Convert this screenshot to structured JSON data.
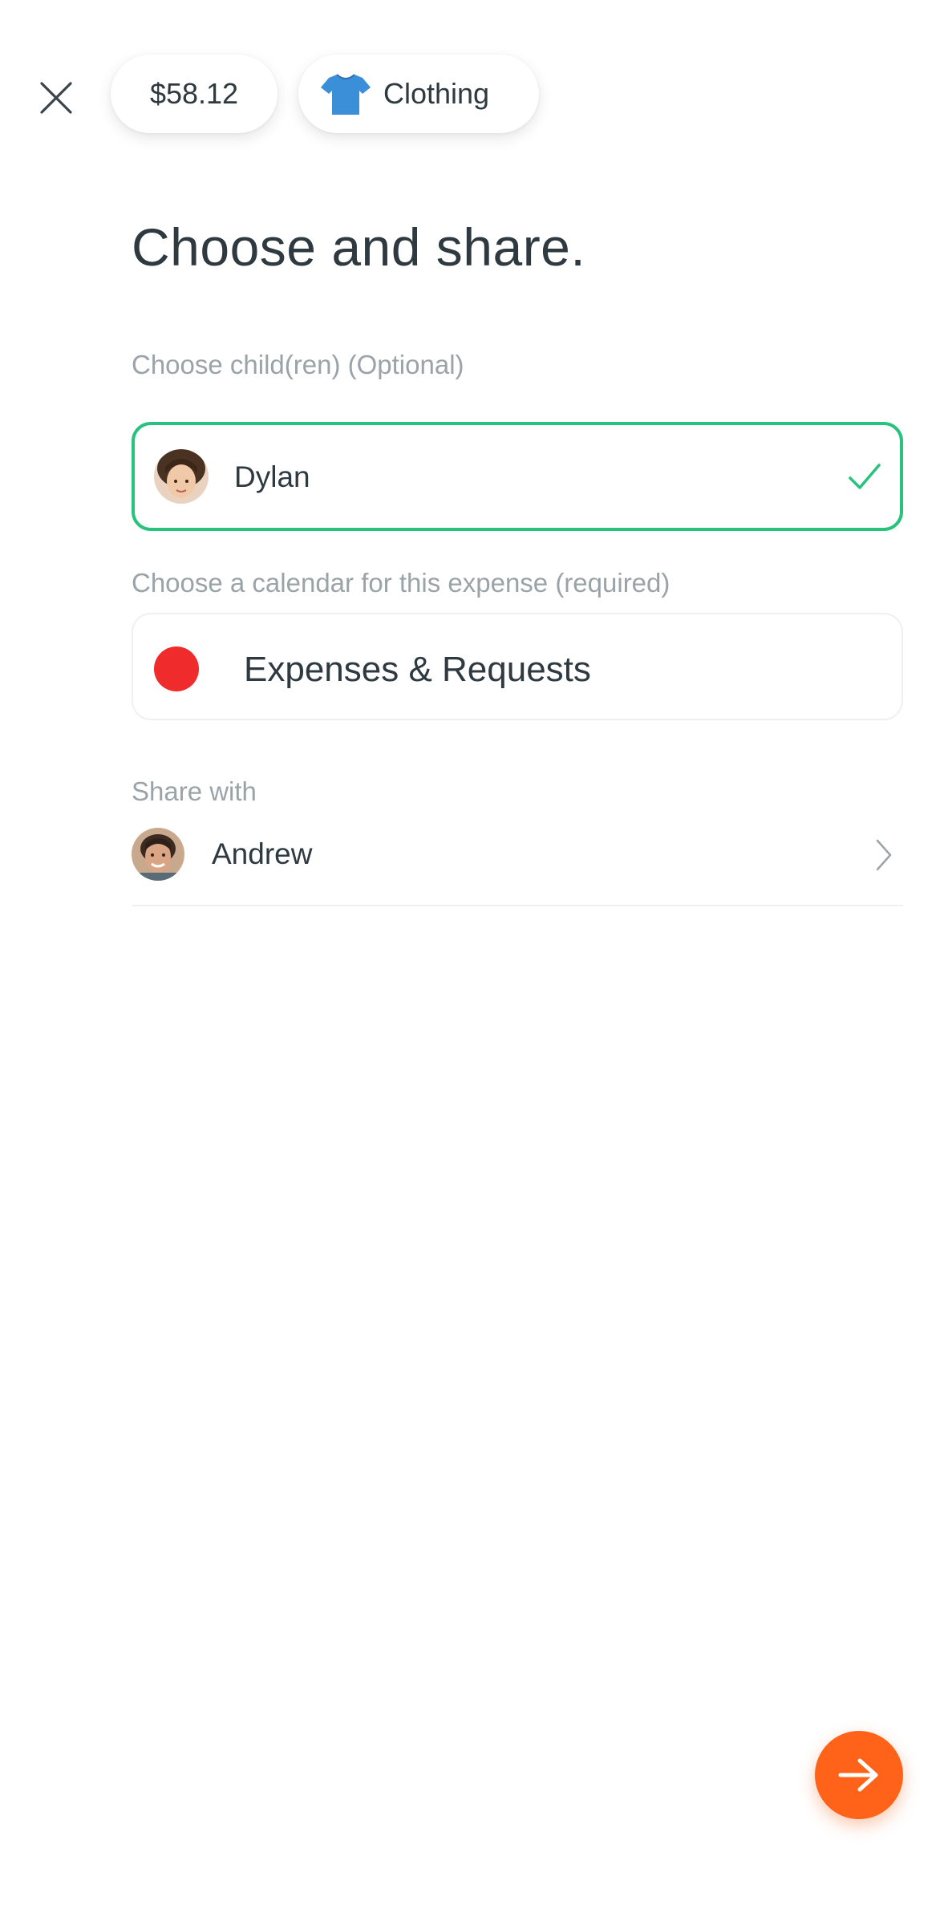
{
  "header": {
    "amount": "$58.12",
    "category": {
      "label": "Clothing",
      "icon": "tshirt-icon"
    },
    "close_icon": "close-icon"
  },
  "title": "Choose and share.",
  "children_section": {
    "label": "Choose child(ren) (Optional)",
    "selected": {
      "name": "Dylan",
      "checked": true
    }
  },
  "calendar_section": {
    "label": "Choose a calendar for this expense (required)",
    "calendar": {
      "name": "Expenses & Requests",
      "color": "#ef2b2b"
    }
  },
  "share_section": {
    "label": "Share with",
    "person": {
      "name": "Andrew"
    }
  },
  "next_button": {
    "icon": "arrow-right-icon",
    "color": "#ff6319"
  },
  "colors": {
    "accent_green": "#27c27c",
    "text": "#2e3940",
    "muted": "#9aa3a8",
    "tshirt": "#3b8fd9"
  }
}
